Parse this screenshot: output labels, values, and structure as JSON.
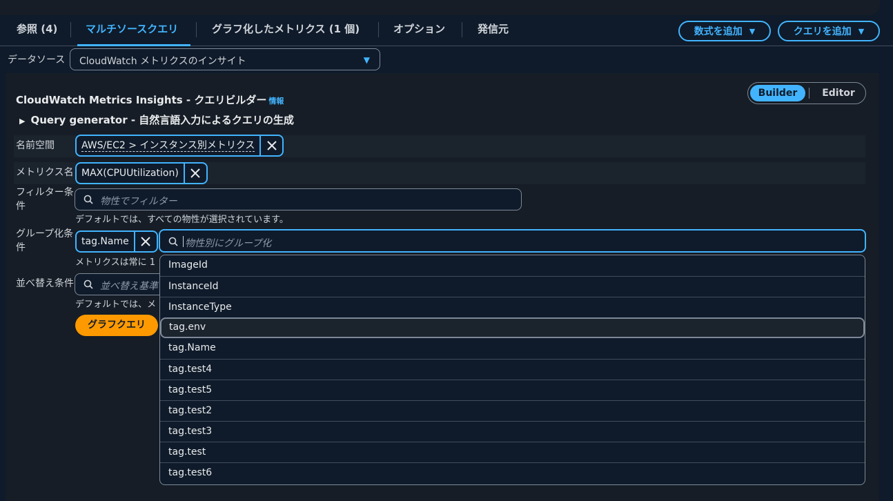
{
  "tabs": [
    {
      "label": "参照 (4)"
    },
    {
      "label": "マルチソースクエリ"
    },
    {
      "label": "グラフ化したメトリクス (1 個)"
    },
    {
      "label": "オプション"
    },
    {
      "label": "発信元"
    }
  ],
  "actions": {
    "add_formula": "数式を追加",
    "add_query": "クエリを追加"
  },
  "datasource": {
    "label": "データソース",
    "value": "CloudWatch メトリクスのインサイト"
  },
  "builder": {
    "title": "CloudWatch Metrics Insights - クエリビルダー",
    "info": "情報",
    "mode_builder": "Builder",
    "mode_editor": "Editor",
    "query_generator": "Query generator - 自然言語入力によるクエリの生成"
  },
  "fields": {
    "namespace": {
      "label": "名前空間",
      "token": "AWS/EC2 > インスタンス別メトリクス"
    },
    "metric": {
      "label": "メトリクス名",
      "token": "MAX(CPUUtilization)"
    },
    "filter": {
      "label": "フィルター条件",
      "placeholder": "物性でフィルター",
      "hint": "デフォルトでは、すべての物性が選択されています。"
    },
    "group": {
      "label": "グループ化条件",
      "token": "tag.Name",
      "placeholder": "物性別にグループ化",
      "hint": "メトリクスは常に 1"
    },
    "order": {
      "label": "並べ替え条件",
      "placeholder": "並べ替え基準",
      "hint": "デフォルトでは、メ"
    }
  },
  "graph_button": "グラフクエリ",
  "dropdown": {
    "options": [
      "ImageId",
      "InstanceId",
      "InstanceType",
      "tag.env",
      "tag.Name",
      "tag.test4",
      "tag.test5",
      "tag.test2",
      "tag.test3",
      "tag.test",
      "tag.test6"
    ],
    "highlighted": "tag.env"
  },
  "colors": {
    "accent": "#42b4ff",
    "primary_button": "#ff9900",
    "background": "#0f1b2a",
    "panel": "#161d26"
  }
}
